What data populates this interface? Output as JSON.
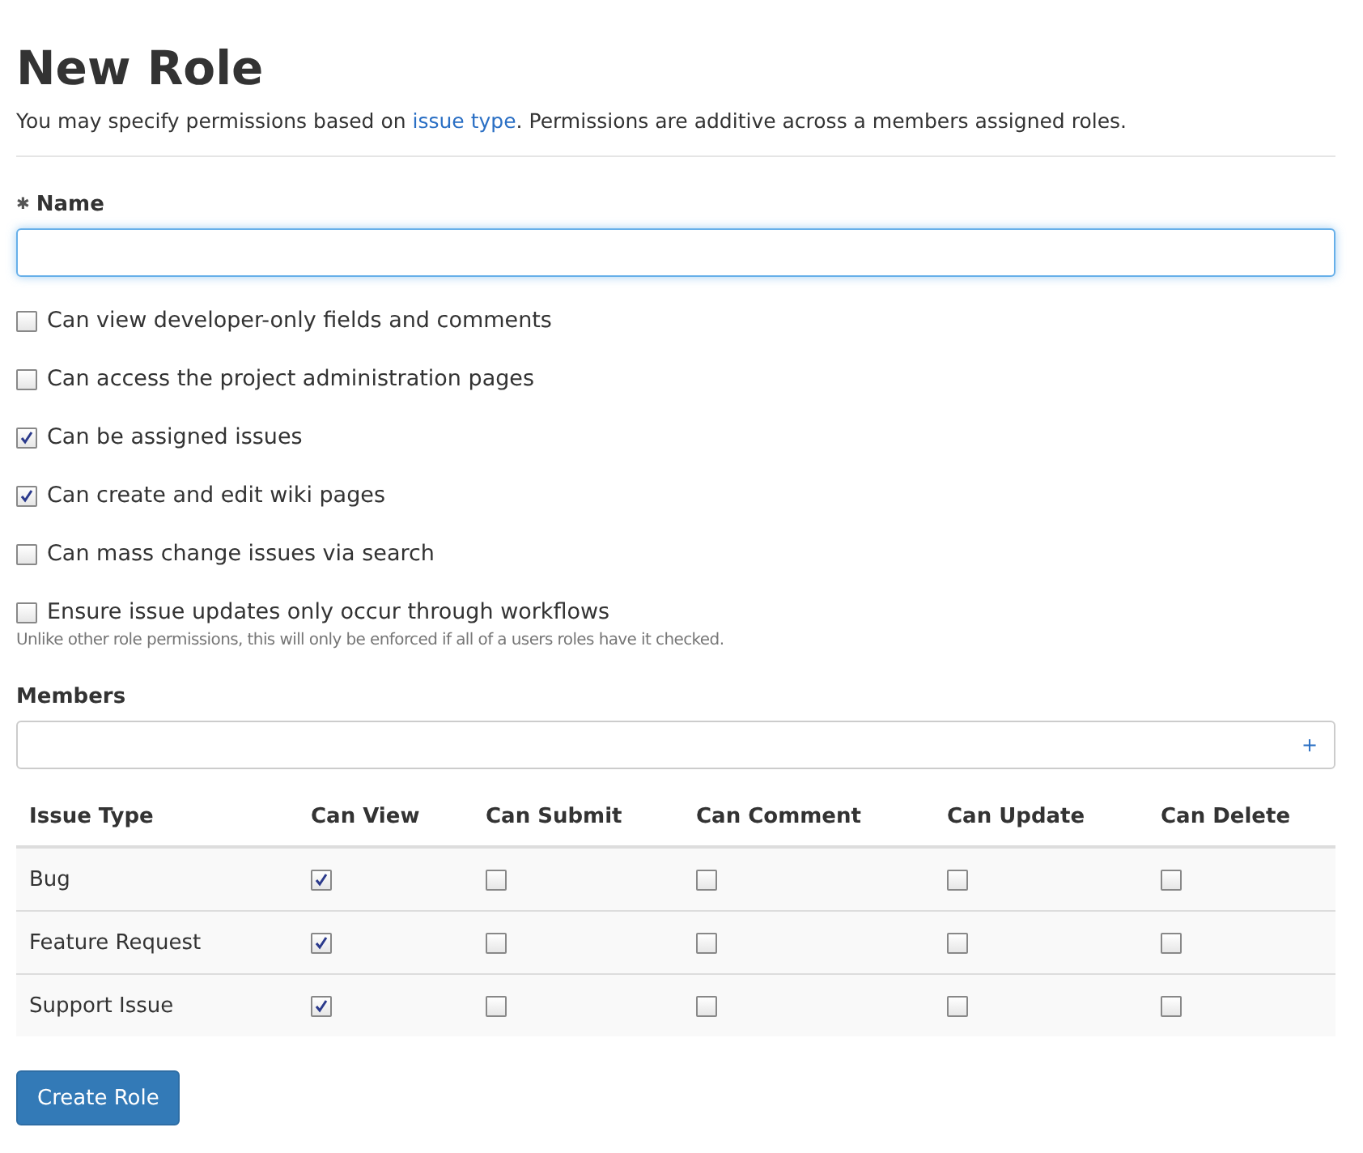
{
  "title": "New Role",
  "intro": {
    "before": "You may specify permissions based on ",
    "link": "issue type",
    "after": ". Permissions are additive across a members assigned roles."
  },
  "name_field": {
    "required_mark": "✱",
    "label": "Name",
    "focused": true
  },
  "permissions": [
    {
      "label": "Can view developer-only fields and comments",
      "checked": false
    },
    {
      "label": "Can access the project administration pages",
      "checked": false
    },
    {
      "label": "Can be assigned issues",
      "checked": true
    },
    {
      "label": "Can create and edit wiki pages",
      "checked": true
    },
    {
      "label": "Can mass change issues via search",
      "checked": false
    },
    {
      "label": "Ensure issue updates only occur through workflows",
      "checked": false,
      "hint": "Unlike other role permissions, this will only be enforced if all of a users roles have it checked."
    }
  ],
  "members": {
    "label": "Members",
    "add": "+"
  },
  "table": {
    "columns": [
      "Issue Type",
      "Can View",
      "Can Submit",
      "Can Comment",
      "Can Update",
      "Can Delete"
    ],
    "rows": [
      {
        "type": "Bug",
        "checks": [
          true,
          false,
          false,
          false,
          false
        ]
      },
      {
        "type": "Feature Request",
        "checks": [
          true,
          false,
          false,
          false,
          false
        ]
      },
      {
        "type": "Support Issue",
        "checks": [
          true,
          false,
          false,
          false,
          false
        ]
      }
    ]
  },
  "submit": "Create Role"
}
